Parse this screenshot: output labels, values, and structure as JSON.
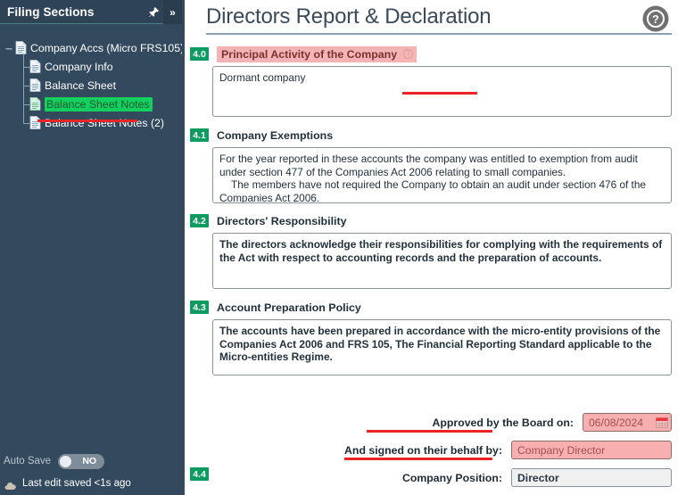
{
  "sidebar": {
    "title": "Filing Sections",
    "pin_icon": "pushpin-icon",
    "collapse_label": "»",
    "tree": {
      "root": {
        "label": "Company Accs (Micro FRS105)"
      },
      "children": [
        {
          "label": "Company Info",
          "selected": false
        },
        {
          "label": "Balance Sheet",
          "selected": false
        },
        {
          "label": "Balance Sheet Notes",
          "selected": true
        },
        {
          "label": "Balance Sheet Notes (2)",
          "selected": false
        }
      ]
    },
    "autosave": {
      "label": "Auto Save",
      "toggle_value": "NO",
      "toggle_on": false
    },
    "save_status": "Last edit saved <1s ago"
  },
  "header": {
    "title": "Directors Report & Declaration",
    "help_icon": "help-circle-icon"
  },
  "sections": {
    "s40": {
      "number": "4.0",
      "label": "Principal Activity of the Company",
      "value": "Dormant company"
    },
    "s41": {
      "number": "4.1",
      "label": "Company Exemptions",
      "line1": "For the year reported in these accounts the company was entitled to exemption from audit under section 477 of the Companies Act 2006 relating to small companies.",
      "line2": "The members have not required the Company to obtain an audit under section 476 of the Companies Act 2006."
    },
    "s42": {
      "number": "4.2",
      "label": "Directors' Responsibility",
      "value": "The directors acknowledge their responsibilities for complying with the requirements of the Act with respect to accounting records and the preparation of accounts."
    },
    "s43": {
      "number": "4.3",
      "label": "Account Preparation Policy",
      "value": "The accounts have been prepared in accordance with the micro-entity provisions of the Companies Act 2006 and FRS 105, The Financial Reporting Standard applicable to the Micro-entities Regime."
    },
    "s44": {
      "number": "4.4"
    }
  },
  "signoff": {
    "approved_label": "Approved by the Board on:",
    "approved_date": "06/08/2024",
    "calendar_icon": "calendar-icon",
    "signed_label": "And signed on their behalf by:",
    "signed_value": "Company Director",
    "position_label": "Company Position:",
    "position_value": "Director"
  },
  "colors": {
    "sidebar_bg": "#33495e",
    "badge_green": "#0e9b62",
    "highlight_green": "#12cf5e",
    "annotation_red": "#ec2327",
    "pink_field": "#f7afaf",
    "pink_label": "#f4b4b4"
  }
}
